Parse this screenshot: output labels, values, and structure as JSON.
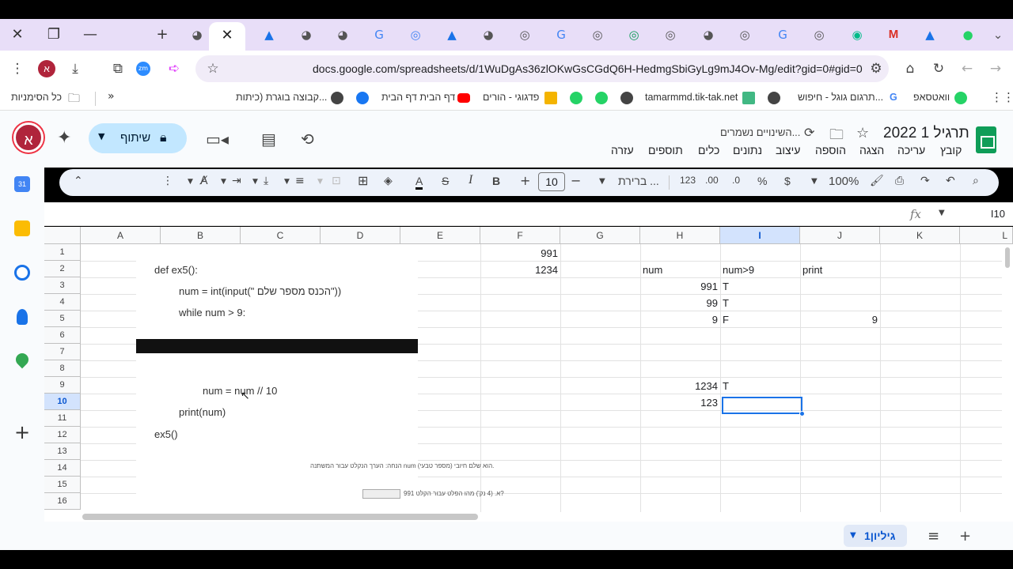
{
  "browser": {
    "url": "docs.google.com/spreadsheets/d/1WuDgAs36zlOKwGsCGdQ6H-HedmgSbiGyLg9mJ4Ov-Mg/edit?gid=0#gid=0",
    "avatar_letter": "א"
  },
  "bookmarks": {
    "all_bookmarks": "כל הסימניות",
    "items": [
      "קבוצה בוגרת (כיתות...",
      "דף הבית דף הבית",
      "פדגוגי - הורים",
      "tamarmmd.tik-tak.net",
      "תרגום גוגל - חיפוש...",
      "וואטסאפ"
    ]
  },
  "app": {
    "title": "תרגיל 1 2022",
    "saved_status": "השינויים נשמרים...",
    "share_label": "שיתוף",
    "account_letter": "א",
    "menus": [
      "קובץ",
      "עריכה",
      "הצגה",
      "הוספה",
      "עיצוב",
      "נתונים",
      "כלים",
      "תוספים",
      "עזרה"
    ]
  },
  "toolbar": {
    "zoom": "100%",
    "currency": "$",
    "percent": "%",
    "dec_decrease": ".0",
    "dec_increase": ".00",
    "number_format": "123",
    "font": "ברירת ...",
    "font_size": "10"
  },
  "formula_bar": {
    "name_box": "I10",
    "fx": "fx"
  },
  "grid": {
    "columns": [
      "A",
      "B",
      "C",
      "D",
      "E",
      "F",
      "G",
      "H",
      "I",
      "J",
      "K",
      "L"
    ],
    "rows": [
      "1",
      "2",
      "3",
      "4",
      "5",
      "6",
      "7",
      "8",
      "9",
      "10",
      "11",
      "12",
      "13",
      "14",
      "15",
      "16"
    ],
    "selected_cell": "I10",
    "cells": {
      "F1": "991",
      "F2": "1234",
      "H2": "num",
      "I2": "num>9",
      "J2": "print",
      "H3": "991",
      "I3": "T",
      "H4": "99",
      "I4": "T",
      "H5": "9",
      "I5": "F",
      "J5": "9",
      "H9": "1234",
      "I9": "T",
      "H10": "123"
    }
  },
  "embedded_image": {
    "code": [
      "def ex5():",
      "num = int(input(\" הכנס מספר שלם\"))",
      "while num > 9:",
      "num = num // 10",
      "print(num)",
      "ex5()"
    ],
    "note": "הנחה: הערך הנקלט עבור המשתנה num הוא שלם חיובי (מספר טבעי).",
    "question": "א. (4 נק') מהו הפלט עבור הקלט 991?"
  },
  "sheets": {
    "active_sheet": "גיליון1"
  }
}
